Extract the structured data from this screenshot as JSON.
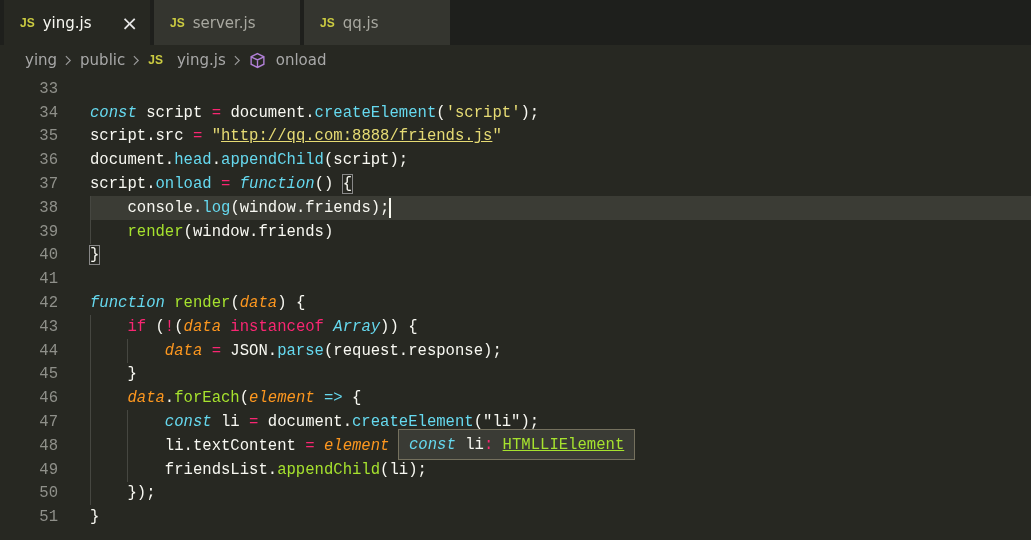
{
  "tabs": [
    {
      "icon": "JS",
      "label": "ying.js",
      "selected": true,
      "close": "×"
    },
    {
      "icon": "JS",
      "label": "server.js",
      "selected": false
    },
    {
      "icon": "JS",
      "label": "qq.js",
      "selected": false
    }
  ],
  "breadcrumb": [
    {
      "kind": "folder",
      "label": "ying"
    },
    {
      "kind": "folder",
      "label": "public"
    },
    {
      "kind": "file",
      "icon": "JS",
      "label": "ying.js"
    },
    {
      "kind": "symbol",
      "label": "onload"
    }
  ],
  "lines": [
    {
      "number": "33",
      "current": false
    },
    {
      "number": "34",
      "current": false,
      "tokens": [
        {
          "text": "const",
          "kind": "keyword"
        },
        {
          "text": " script",
          "kind": "plain"
        },
        {
          "text": " =",
          "kind": "operator"
        },
        {
          "text": " document.",
          "kind": "plain"
        },
        {
          "text": "createElement",
          "kind": "property"
        },
        {
          "text": "(",
          "kind": "plain"
        },
        {
          "text": "'script'",
          "kind": "string"
        },
        {
          "text": ");",
          "kind": "plain"
        }
      ]
    },
    {
      "number": "35",
      "current": false,
      "tokens": [
        {
          "text": "script.src",
          "kind": "plain"
        },
        {
          "text": " =",
          "kind": "operator"
        },
        {
          "text": " \"",
          "kind": "string"
        },
        {
          "text": "http://qq.com:8888/friends.js",
          "kind": "link"
        },
        {
          "text": "\"",
          "kind": "string"
        }
      ]
    },
    {
      "number": "36",
      "current": false,
      "tokens": [
        {
          "text": "document.",
          "kind": "plain"
        },
        {
          "text": "head",
          "kind": "property"
        },
        {
          "text": ".",
          "kind": "plain"
        },
        {
          "text": "appendChild",
          "kind": "property"
        },
        {
          "text": "(script);",
          "kind": "plain"
        }
      ]
    },
    {
      "number": "37",
      "current": false,
      "tokens": [
        {
          "text": "script.",
          "kind": "plain"
        },
        {
          "text": "onload",
          "kind": "property"
        },
        {
          "text": " =",
          "kind": "operator"
        },
        {
          "text": " function",
          "kind": "keyword"
        },
        {
          "text": "() ",
          "kind": "plain"
        },
        {
          "text": "{",
          "kind": "bracket"
        }
      ]
    },
    {
      "number": "38",
      "current": true,
      "tokens": [
        {
          "text": "    console.",
          "kind": "plain"
        },
        {
          "text": "log",
          "kind": "property"
        },
        {
          "text": "(window.friends);",
          "kind": "plain"
        }
      ]
    },
    {
      "number": "39",
      "current": false,
      "tokens": [
        {
          "text": "    render",
          "kind": "function"
        },
        {
          "text": "(window.friends)",
          "kind": "plain"
        }
      ]
    },
    {
      "number": "40",
      "current": false,
      "tokens": [
        {
          "text": "}",
          "kind": "bracket"
        }
      ]
    },
    {
      "number": "41",
      "current": false
    },
    {
      "number": "42",
      "current": false,
      "tokens": [
        {
          "text": "function",
          "kind": "keyword"
        },
        {
          "text": " render",
          "kind": "function"
        },
        {
          "text": "(",
          "kind": "plain"
        },
        {
          "text": "data",
          "kind": "param"
        },
        {
          "text": ") {",
          "kind": "plain"
        }
      ]
    },
    {
      "number": "43",
      "current": false,
      "tokens": [
        {
          "text": "    if",
          "kind": "control"
        },
        {
          "text": " (",
          "kind": "plain"
        },
        {
          "text": "!",
          "kind": "operator"
        },
        {
          "text": "(",
          "kind": "plain"
        },
        {
          "text": "data",
          "kind": "param"
        },
        {
          "text": " instanceof",
          "kind": "control"
        },
        {
          "text": " Array",
          "kind": "type"
        },
        {
          "text": ")) {",
          "kind": "plain"
        }
      ]
    },
    {
      "number": "44",
      "current": false,
      "tokens": [
        {
          "text": "        data",
          "kind": "param"
        },
        {
          "text": " =",
          "kind": "operator"
        },
        {
          "text": " JSON.",
          "kind": "plain"
        },
        {
          "text": "parse",
          "kind": "property"
        },
        {
          "text": "(request.response);",
          "kind": "plain"
        }
      ]
    },
    {
      "number": "45",
      "current": false,
      "tokens": [
        {
          "text": "    }",
          "kind": "plain"
        }
      ]
    },
    {
      "number": "46",
      "current": false,
      "tokens": [
        {
          "text": "    data",
          "kind": "param"
        },
        {
          "text": ".",
          "kind": "plain"
        },
        {
          "text": "forEach",
          "kind": "function"
        },
        {
          "text": "(",
          "kind": "plain"
        },
        {
          "text": "element",
          "kind": "param"
        },
        {
          "text": " =>",
          "kind": "keyword"
        },
        {
          "text": " {",
          "kind": "plain"
        }
      ]
    },
    {
      "number": "47",
      "current": false,
      "tokens": [
        {
          "text": "        const",
          "kind": "keyword"
        },
        {
          "text": " li",
          "kind": "plain"
        },
        {
          "text": " =",
          "kind": "operator"
        },
        {
          "text": " document.",
          "kind": "plain"
        },
        {
          "text": "createElement",
          "kind": "property"
        },
        {
          "text": "(\"li\");",
          "kind": "plain"
        }
      ]
    },
    {
      "number": "48",
      "current": false,
      "tokens": [
        {
          "text": "        li.textContent",
          "kind": "plain"
        },
        {
          "text": " =",
          "kind": "operator"
        },
        {
          "text": " element",
          "kind": "param"
        }
      ]
    },
    {
      "number": "49",
      "current": false,
      "tokens": [
        {
          "text": "        friendsList.",
          "kind": "plain"
        },
        {
          "text": "appendChild",
          "kind": "function"
        },
        {
          "text": "(li);",
          "kind": "plain"
        }
      ]
    },
    {
      "number": "50",
      "current": false,
      "tokens": [
        {
          "text": "    });",
          "kind": "plain"
        }
      ]
    },
    {
      "number": "51",
      "current": false,
      "tokens": [
        {
          "text": "}",
          "kind": "plain"
        }
      ]
    }
  ],
  "tooltip": {
    "keyword": "const",
    "name": "li",
    "separator": ":",
    "type": "HTMLLIElement"
  }
}
